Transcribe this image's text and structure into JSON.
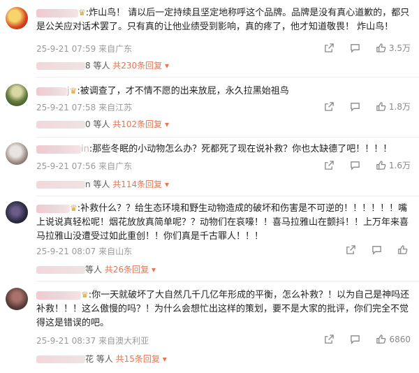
{
  "comments": [
    {
      "name_tail": "",
      "has_crown": true,
      "text": ":炸山鸟！ 请以后一定持续且坚定地称呼这个品牌。品牌是没有真心道歉的，都只是公关应对话术罢了。只有真的让他业绩受到影响，真的疼了，他才知道敬畏！ 炸山鸟！",
      "date": "25-9-21 07:59",
      "location": "来自广东",
      "likes": "3.5万",
      "replies_tail": "8 等人",
      "replies_total": "共230条回复",
      "more_icon": "caret-down-icon"
    },
    {
      "name_tail": "j",
      "has_crown": true,
      "text": ":被调查了，才不情不愿的出来放屁，永久拉黑始祖鸟",
      "date": "25-9-21 07:58",
      "location": "来自江苏",
      "likes": "1.8万",
      "replies_tail": "0 等人",
      "replies_total": "共102条回复",
      "more_icon": "caret-down-icon"
    },
    {
      "name_tail": "in",
      "has_crown": false,
      "text": ":那些冬眠的小动物怎么办？死都死了现在说补救？你也太缺德了吧！！！！",
      "date": "25-9-21 07:56",
      "location": "来自广东",
      "likes": "1.6万",
      "replies_tail": "n 等人",
      "replies_total": "共114条回复",
      "more_icon": "caret-down-icon"
    },
    {
      "name_tail": "",
      "has_crown": true,
      "text": ":补救什么？？给生态环境和野生动物造成的破坏和伤害是不可逆的！！！！！！嘴上说说真轻松呢！烟花放放真简单呢？？动物们在哀嚎！！喜马拉雅山在颤抖！！上万年来喜马拉雅山没遭受过如此重创！！你们真是千古罪人！！！",
      "date": "25-9-21 08:07",
      "location": "来自山东",
      "likes": "",
      "replies_tail": "等人",
      "replies_total": "共26条回复",
      "more_icon": "caret-down-icon"
    },
    {
      "name_tail": "",
      "has_crown": true,
      "text": ":你一天就破坏了大自然几千几亿年形成的平衡，怎么补救？！以为自己是神吗还补救！！！这么傲慢的吗？！为什么会想忙出这样的策划，要不是大家的批评，你们完全不觉得这是错误的吧。",
      "date": "25-9-21 08:37",
      "location": "来自澳大利亚",
      "likes": "6860",
      "replies_tail": "花 等人",
      "replies_total": "共15条回复",
      "more_icon": "caret-down-icon"
    }
  ],
  "icons": {
    "share": "share-icon",
    "comment": "comment-icon",
    "like": "like-icon",
    "crown": "crown-icon"
  },
  "colors": {
    "accent": "#eb7350",
    "meta": "#9a9a9a"
  }
}
